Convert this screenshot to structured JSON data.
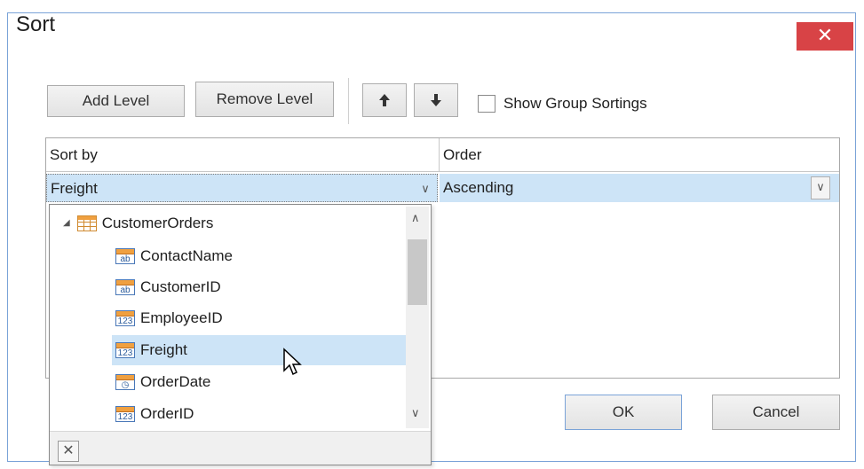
{
  "window": {
    "title": "Sort",
    "close_glyph": "✕"
  },
  "toolbar": {
    "add_level": "Add Level",
    "remove_level": "Remove Level",
    "move_up_icon": "arrow-up-icon",
    "move_down_icon": "arrow-down-icon",
    "show_group_sortings": "Show Group Sortings",
    "show_group_sortings_checked": false
  },
  "grid": {
    "columns": [
      "Sort by",
      "Order"
    ],
    "rows": [
      {
        "sort_by": "Freight",
        "order": "Ascending"
      }
    ]
  },
  "field_list": {
    "root": "CustomerOrders",
    "items": [
      {
        "label": "ContactName",
        "icon": "ab"
      },
      {
        "label": "CustomerID",
        "icon": "ab"
      },
      {
        "label": "EmployeeID",
        "icon": "123"
      },
      {
        "label": "Freight",
        "icon": "123",
        "selected": true
      },
      {
        "label": "OrderDate",
        "icon": "clock"
      },
      {
        "label": "OrderID",
        "icon": "123"
      }
    ]
  },
  "buttons": {
    "ok": "OK",
    "cancel": "Cancel"
  },
  "colors": {
    "selection": "#cde4f7",
    "close": "#d84346",
    "border": "#7aa3d8"
  }
}
